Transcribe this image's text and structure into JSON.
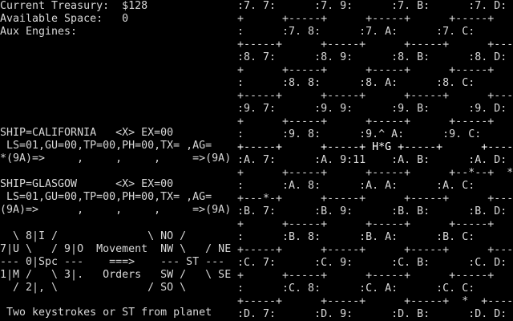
{
  "status": {
    "treasury": "Current Treasury:  $128",
    "space": "Available Space:   0",
    "aux": "Aux Engines:"
  },
  "ships": [
    {
      "name": "SHIP=CALIFORNIA   <X> EX=00",
      "stats": " LS=01,GU=00,TP=00,PH=00,TX= ,AG=",
      "route": "*(9A)=>     ,     ,     ,     =>(9A)"
    },
    {
      "name": "SHIP=GLASGOW      <X> EX=00",
      "stats": " LS=01,GU=00,TP=00,PH=00,TX= ,AG=",
      "route": "(9A)=>      ,     ,     ,     =>(9A)"
    }
  ],
  "keypad": {
    "row1": "  \\ 8|I /              \\ NO /",
    "row2": "7|U \\   / 9|O  Movement  NW \\   / NE",
    "row3": "--- 0|Spc ---    ===>    --- ST ---",
    "row4": "1|M /   \\ 3|.   Orders   SW /   \\ SE",
    "row5": "  / 2|, \\              / SO \\"
  },
  "hint": " Two keystrokes or ST from planet",
  "sector_map": [
    ":7. 7:      :7. 9:      :7. B:      :7. D:",
    "+      +-----+      +-----+      +-----+",
    ":      :7. 8:      :7. A:      :7. C:",
    "+-----+      +-----+      +-----+      +-----",
    ":8. 7:      :8. 9:      :8. B:      :8. D:",
    "+      +-----+      +-----+      +-----+",
    ":      :8. 8:      :8. A:      :8. C:",
    "+-----+      +-----+      +-----+      +-----",
    ":9. 7:      :9. 9:      :9. B:      :9. D:",
    "+      +-----+      +-----+      +-----+",
    ":      :9. 8:      :9.^ A:      :9. C:",
    "+-----+      +-----+ H*G +-----+      +-----",
    ":A. 7:      :A. 9:11    :A. B:      :A. D:",
    "+      +-----+      +-----+      +--*--+  *",
    ":      :A. 8:      :A. A:      :A. C:",
    "+---*-+      +-----+      +-----+      +-----",
    ":B. 7:      :B. 9:      :B. B:      :B. D:",
    "+      +-----+      +-----+      +-----+",
    ":      :B. 8:      :B. A:      :B. C:",
    "+-----+      +-----+      +-----+      +-----",
    ":C. 7:      :C. 9:      :C. B:      :C. D:",
    "+      +-----+      +-----+      +-----+",
    ":      :C. 8:      :C. A:      :C. C:",
    "+-----+      +-----+      +-----+  *  +-----",
    ":D. 7:      :D. 9:      :D. B:      :D. D:"
  ]
}
